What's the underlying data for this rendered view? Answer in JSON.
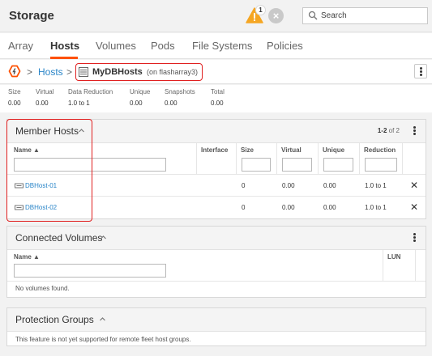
{
  "app": {
    "title": "Storage"
  },
  "header": {
    "alert_count": "1",
    "search_placeholder": "Search"
  },
  "tabs": [
    {
      "label": "Array"
    },
    {
      "label": "Hosts"
    },
    {
      "label": "Volumes"
    },
    {
      "label": "Pods"
    },
    {
      "label": "File Systems"
    },
    {
      "label": "Policies"
    }
  ],
  "breadcrumb": {
    "separator": ">",
    "parent": "Hosts",
    "current": "MyDBHosts",
    "current_sub": "(on flasharray3)"
  },
  "stats": [
    {
      "label": "Size",
      "value": "0.00"
    },
    {
      "label": "Virtual",
      "value": "0.00"
    },
    {
      "label": "Data Reduction",
      "value": "1.0 to 1"
    },
    {
      "label": "Unique",
      "value": "0.00"
    },
    {
      "label": "Snapshots",
      "value": "0.00"
    },
    {
      "label": "Total",
      "value": "0.00"
    }
  ],
  "member_hosts": {
    "title": "Member Hosts",
    "pager_range": "1-2",
    "pager_of": "of 2",
    "columns": [
      "Name ▲",
      "Interface",
      "Size",
      "Virtual",
      "Unique",
      "Reduction"
    ],
    "rows": [
      {
        "name": "DBHost-01",
        "size": "0",
        "virtual": "0.00",
        "unique": "0.00",
        "reduction": "1.0 to 1"
      },
      {
        "name": "DBHost-02",
        "size": "0",
        "virtual": "0.00",
        "unique": "0.00",
        "reduction": "1.0 to 1"
      }
    ]
  },
  "connected_volumes": {
    "title": "Connected Volumes",
    "columns": [
      "Name ▲",
      "LUN"
    ],
    "empty": "No volumes found."
  },
  "protection_groups": {
    "title": "Protection Groups",
    "message": "This feature is not yet supported for remote fleet host groups."
  },
  "colors": {
    "accent": "#fe5000",
    "link": "#2a85c8",
    "highlight": "#e02020",
    "warning": "#f5a623"
  }
}
